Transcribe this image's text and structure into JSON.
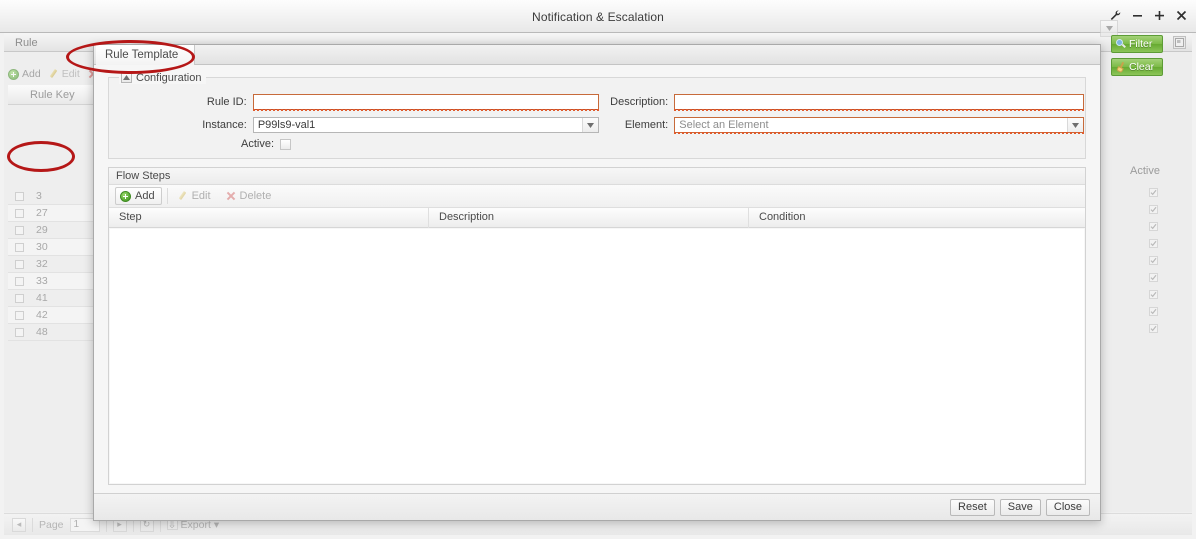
{
  "window": {
    "title": "Notification & Escalation",
    "controls": [
      {
        "name": "settings-wrench",
        "glyph": "⚒"
      },
      {
        "name": "minimize",
        "glyph": "–"
      },
      {
        "name": "maximize",
        "glyph": "+"
      },
      {
        "name": "close",
        "glyph": "×"
      }
    ]
  },
  "background": {
    "tab_label": "Rule",
    "toolbar": {
      "add_label": "Add",
      "edit_label": "Edit"
    },
    "grid": {
      "key_column": "Rule Key",
      "active_column": "Active",
      "rows": [
        {
          "key": "3",
          "active": true
        },
        {
          "key": "27",
          "active": true
        },
        {
          "key": "29",
          "active": true
        },
        {
          "key": "30",
          "active": true
        },
        {
          "key": "32",
          "active": true
        },
        {
          "key": "33",
          "active": true
        },
        {
          "key": "41",
          "active": true
        },
        {
          "key": "42",
          "active": true
        },
        {
          "key": "48",
          "active": true
        }
      ]
    },
    "filter_button": "Filter",
    "clear_button": "Clear",
    "statusbar": {
      "page_label": "Page",
      "page_value": "1",
      "export_label": "Export"
    }
  },
  "dialog": {
    "tab_label": "Rule Template",
    "configuration": {
      "legend": "Configuration",
      "fields": {
        "rule_id_label": "Rule ID:",
        "rule_id_value": "",
        "description_label": "Description:",
        "description_value": "",
        "instance_label": "Instance:",
        "instance_value": "P99ls9-val1",
        "element_label": "Element:",
        "element_value": "Select an Element",
        "active_label": "Active:",
        "active_checked": false
      }
    },
    "flow_steps": {
      "title": "Flow Steps",
      "toolbar": {
        "add_label": "Add",
        "edit_label": "Edit",
        "delete_label": "Delete"
      },
      "columns": [
        "Step",
        "Description",
        "Condition"
      ],
      "rows": []
    },
    "footer": {
      "reset_label": "Reset",
      "save_label": "Save",
      "close_label": "Close"
    }
  },
  "colors": {
    "accent_green": "#7cba46",
    "required_red": "#c76a3a",
    "annotation_red": "#b51717",
    "title_text": "#3b3b3b"
  }
}
